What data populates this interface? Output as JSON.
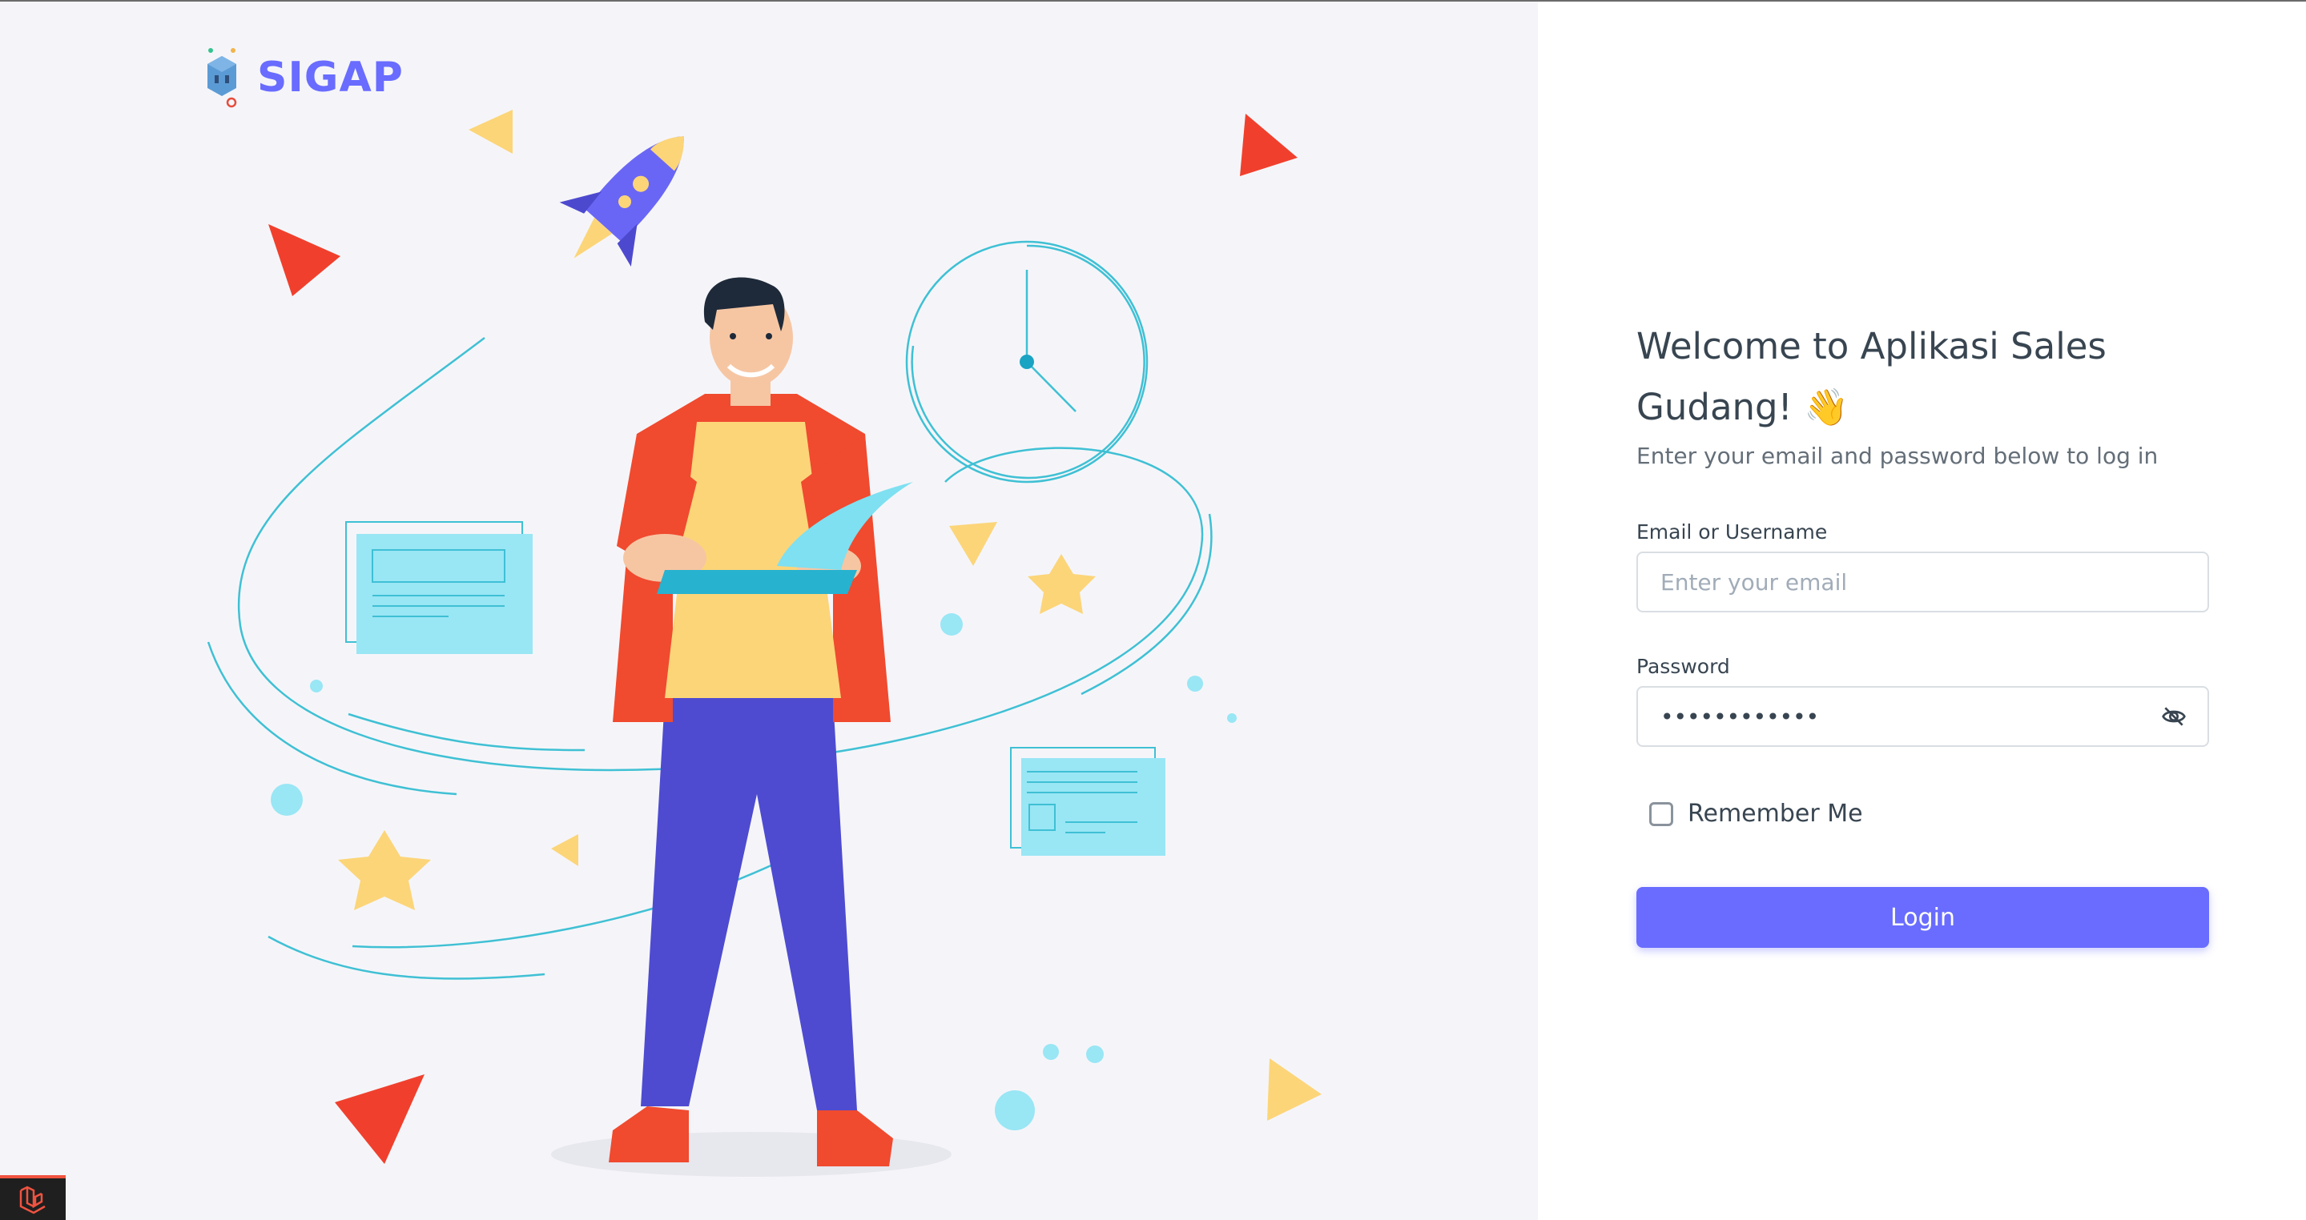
{
  "brand": {
    "name": "SIGAP",
    "logo_icon": "robot-logo-icon"
  },
  "login": {
    "title": "Welcome to Aplikasi Sales Gudang! 👋",
    "subtitle": "Enter your email and password below to log in",
    "email_label": "Email or Username",
    "email_placeholder": "Enter your email",
    "email_value": "",
    "password_label": "Password",
    "password_value": "••••••••••••",
    "password_toggle_icon": "eye-off-icon",
    "remember_label": "Remember Me",
    "remember_checked": false,
    "login_button": "Login"
  },
  "colors": {
    "accent": "#696cff",
    "text": "#384551",
    "muted": "#646e78",
    "panel": "#f5f5f9"
  }
}
